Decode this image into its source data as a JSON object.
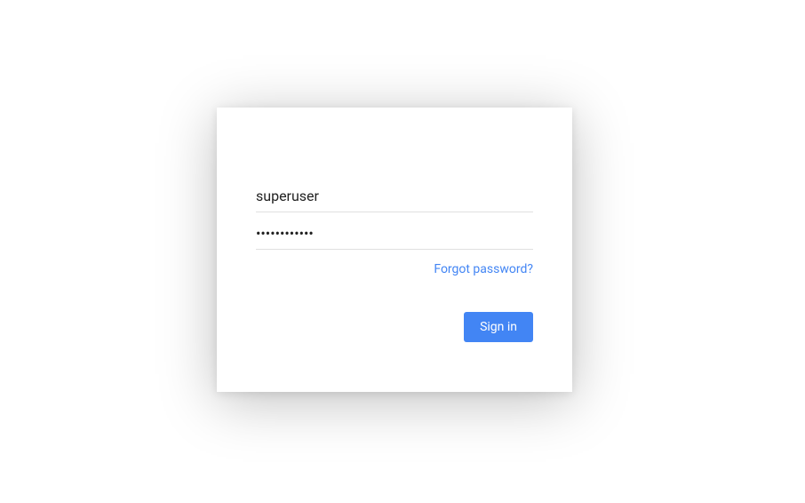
{
  "login": {
    "username_value": "superuser",
    "password_value": "••••••••••••",
    "forgot_password_label": "Forgot password?",
    "signin_button_label": "Sign in"
  }
}
